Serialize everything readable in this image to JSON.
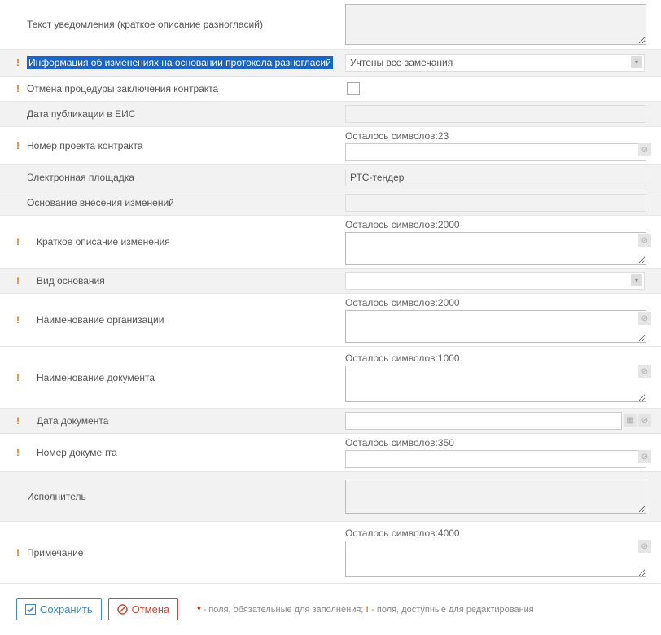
{
  "labels": {
    "notification_text": "Текст уведомления (краткое описание разногласий)",
    "info_changes": "Информация об изменениях на основании протокола разногласий",
    "cancel_procedure": "Отмена процедуры заключения контракта",
    "pub_date": "Дата публикации в ЕИС",
    "project_number": "Номер проекта контракта",
    "platform": "Электронная площадка",
    "change_basis": "Основание внесения изменений",
    "change_desc": "Краткое описание изменения",
    "basis_type": "Вид основания",
    "org_name": "Наименование организации",
    "doc_name": "Наименование документа",
    "doc_date": "Дата документа",
    "doc_number": "Номер документа",
    "executor": "Исполнитель",
    "note": "Примечание"
  },
  "values": {
    "info_changes_selected": "Учтены все замечания",
    "platform_value": "РТС-тендер"
  },
  "counters": {
    "project_number": "Осталось символов:23",
    "change_desc": "Осталось символов:2000",
    "org_name": "Осталось символов:2000",
    "doc_name": "Осталось символов:1000",
    "doc_number": "Осталось символов:350",
    "note": "Осталось символов:4000"
  },
  "buttons": {
    "save": "Сохранить",
    "cancel": "Отмена"
  },
  "legend": {
    "star": "*",
    "star_text": " - поля, обязательные для заполнения;  ",
    "excl": "!",
    "excl_text": " - поля, доступные для редактирования"
  }
}
